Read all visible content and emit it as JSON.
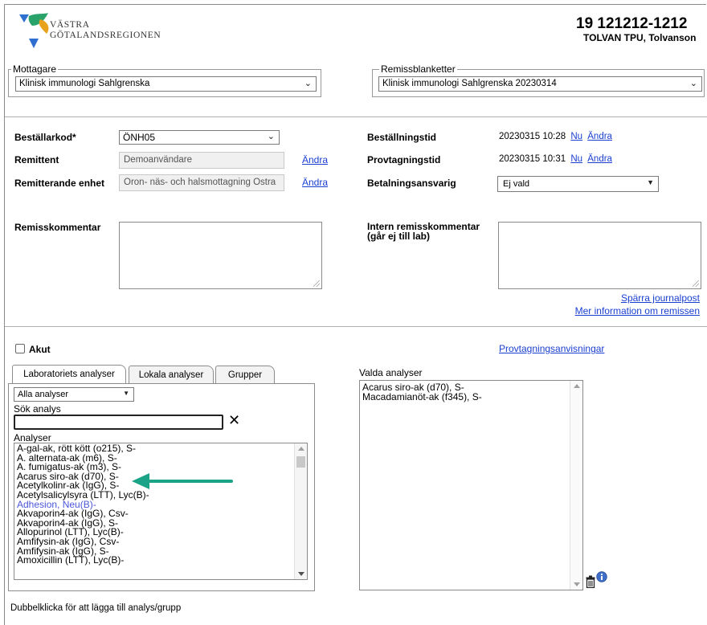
{
  "header": {
    "logo_line1": "VÄSTRA",
    "logo_line2": "GÖTALANDSREGIONEN",
    "patient_id": "19 121212-1212",
    "patient_name": "TOLVAN TPU, Tolvanson"
  },
  "mottagare": {
    "legend": "Mottagare",
    "selected": "Klinisk immunologi Sahlgrenska"
  },
  "remissblanketter": {
    "legend": "Remissblanketter",
    "selected": "Klinisk immunologi Sahlgrenska 20230314"
  },
  "form": {
    "bestallarkod_label": "Beställarkod*",
    "bestallarkod_value": "ÖNH05",
    "remittent_label": "Remittent",
    "remittent_value": "Demoanvändare",
    "remitterande_label": "Remitterande enhet",
    "remitterande_value": "Oron- näs- och halsmottagning Ostra",
    "andra": "Ändra",
    "bestallningstid_label": "Beställningstid",
    "bestallningstid_value": "20230315 10:28",
    "provtagningstid_label": "Provtagningstid",
    "provtagningstid_value": "20230315 10:31",
    "nu": "Nu",
    "betalning_label": "Betalningsansvarig",
    "betalning_value": "Ej vald",
    "remisskommentar_label": "Remisskommentar",
    "intern_label_1": "Intern remisskommentar",
    "intern_label_2": "(går ej till lab)",
    "sparra": "Spärra journalpost",
    "mer_info": "Mer information om remissen"
  },
  "analysis": {
    "akut_label": "Akut",
    "provtagningsanvisningar": "Provtagningsanvisningar",
    "tabs": [
      "Laboratoriets analyser",
      "Lokala analyser",
      "Grupper"
    ],
    "filter_selected": "Alla analyser",
    "search_label": "Sök analys",
    "search_value": "",
    "clear_icon": "close-icon",
    "list_label": "Analyser",
    "items": [
      "A-gal-ak, rött kött (o215), S-",
      "A. alternata-ak (m6), S-",
      "A. fumigatus-ak (m3), S-",
      "Acarus siro-ak (d70), S-",
      "Acetylkolinr-ak (IgG), S-",
      "Acetylsalicylsyra (LTT), Lyc(B)-",
      "Adhesion, Neu(B)-",
      "Akvaporin4-ak (IgG), Csv-",
      "Akvaporin4-ak (IgG), S-",
      "Allopurinol (LTT), Lyc(B)-",
      "Amfifysin-ak (IgG), Csv-",
      "Amfifysin-ak (IgG), S-",
      "Amoxicillin (LTT), Lyc(B)-"
    ],
    "highlight_index": 6,
    "valda_label": "Valda analyser",
    "valda_items": [
      "Acarus siro-ak (d70), S-",
      "Macadamianöt-ak (f345), S-"
    ],
    "footer_hint": "Dubbelklicka för att lägga till analys/grupp",
    "arrow_color": "#1aa386",
    "link_color": "#1a3fd1"
  }
}
